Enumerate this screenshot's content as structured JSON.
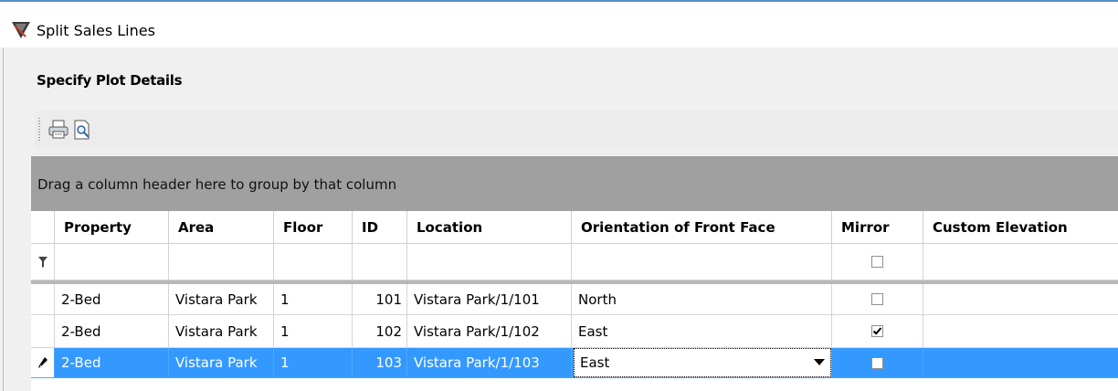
{
  "window": {
    "title": "Split Sales Lines",
    "app_icon": "app-icon"
  },
  "section": {
    "title": "Specify Plot Details"
  },
  "toolbar": {
    "buttons": [
      {
        "icon": "printer-icon"
      },
      {
        "icon": "print-preview-icon"
      }
    ]
  },
  "grid": {
    "group_panel_text": "Drag a column header here to group by that column",
    "columns": [
      "Property",
      "Area",
      "Floor",
      "ID",
      "Location",
      "Orientation of Front Face",
      "Mirror",
      "Custom Elevation"
    ],
    "filter_row": {
      "mirror_checked": false
    },
    "rows": [
      {
        "property": "2-Bed",
        "area": "Vistara Park",
        "floor": "1",
        "id": "101",
        "location": "Vistara Park/1/101",
        "orientation": "North",
        "mirror": false,
        "custom_elevation": ""
      },
      {
        "property": "2-Bed",
        "area": "Vistara Park",
        "floor": "1",
        "id": "102",
        "location": "Vistara Park/1/102",
        "orientation": "East",
        "mirror": true,
        "custom_elevation": ""
      },
      {
        "property": "2-Bed",
        "area": "Vistara Park",
        "floor": "1",
        "id": "103",
        "location": "Vistara Park/1/103",
        "orientation": "East",
        "mirror": false,
        "custom_elevation": "",
        "selected": true,
        "editing": true
      }
    ]
  },
  "colors": {
    "selection": "#3399ff",
    "group_panel": "#a0a0a0"
  }
}
